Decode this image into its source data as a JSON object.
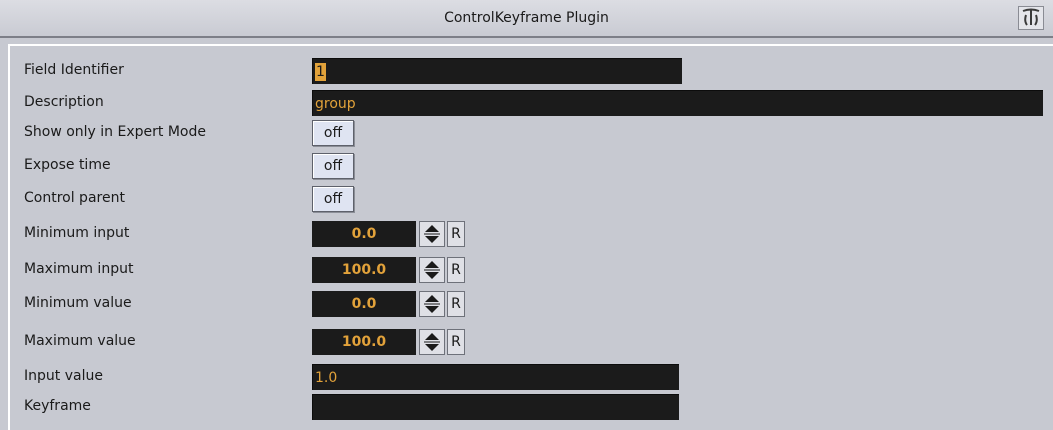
{
  "window": {
    "title": "ControlKeyframe Plugin",
    "logo_icon": "vizrt-logo-icon"
  },
  "fields": {
    "field_identifier": {
      "label": "Field Identifier",
      "value": "1"
    },
    "description": {
      "label": "Description",
      "value": "group"
    },
    "show_expert": {
      "label": "Show only in Expert Mode",
      "value": "off"
    },
    "expose_time": {
      "label": "Expose time",
      "value": "off"
    },
    "control_parent": {
      "label": "Control parent",
      "value": "off"
    },
    "min_input": {
      "label": "Minimum input",
      "value": "0.0",
      "reset": "R"
    },
    "max_input": {
      "label": "Maximum input",
      "value": "100.0",
      "reset": "R"
    },
    "min_value": {
      "label": "Minimum value",
      "value": "0.0",
      "reset": "R"
    },
    "max_value": {
      "label": "Maximum value",
      "value": "100.0",
      "reset": "R"
    },
    "input_value": {
      "label": "Input value",
      "value": "1.0"
    },
    "keyframe": {
      "label": "Keyframe",
      "value": ""
    }
  },
  "colors": {
    "background": "#c7c9d1",
    "field_bg": "#1b1b1b",
    "field_text": "#e2a23a",
    "toggle_bg": "#dfe4f2"
  }
}
